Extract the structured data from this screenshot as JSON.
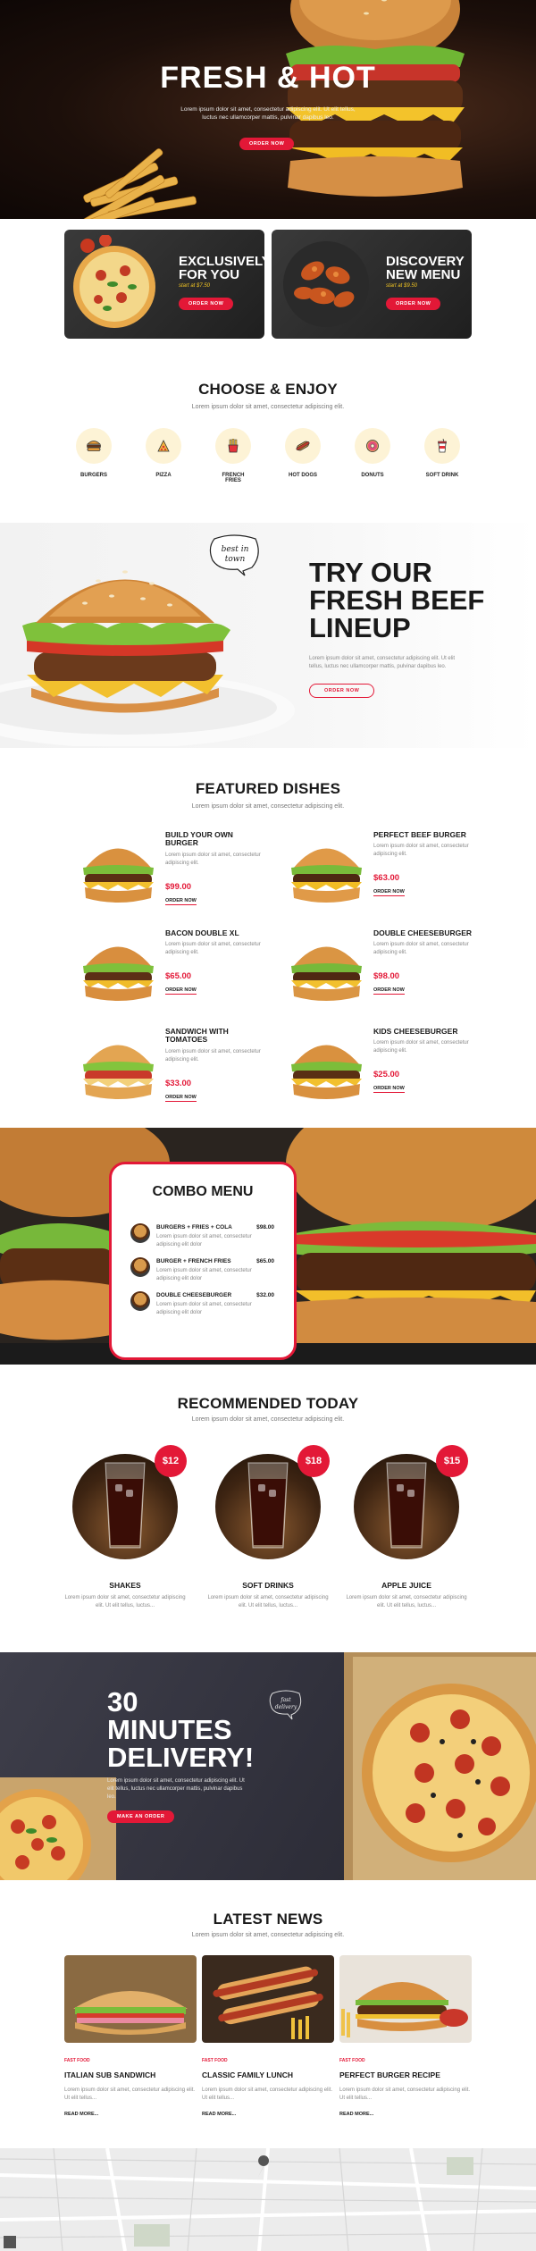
{
  "hero": {
    "title": "FRESH & HOT",
    "subtitle": "Lorem ipsum dolor sit amet, consectetur adipiscing elit. Ut elit tellus, luctus nec ullamcorper mattis, pulvinar dapibus leo.",
    "button": "ORDER NOW"
  },
  "promos": [
    {
      "title_line1": "EXCLUSIVELY",
      "title_line2": "FOR YOU",
      "price": "start at $7.50",
      "button": "ORDER NOW"
    },
    {
      "title_line1": "DISCOVERY",
      "title_line2": "NEW MENU",
      "price": "start at $9.50",
      "button": "ORDER NOW"
    }
  ],
  "choose": {
    "title": "CHOOSE & ENJOY",
    "subtitle": "Lorem ipsum dolor sit amet, consectetur adipiscing elit.",
    "categories": [
      {
        "label": "BURGERS",
        "icon": "burger-icon"
      },
      {
        "label": "PIZZA",
        "icon": "pizza-icon"
      },
      {
        "label": "FRENCH FRIES",
        "icon": "fries-icon"
      },
      {
        "label": "HOT DOGS",
        "icon": "hotdog-icon"
      },
      {
        "label": "DONUTS",
        "icon": "donut-icon"
      },
      {
        "label": "SOFT DRINK",
        "icon": "soda-icon"
      }
    ]
  },
  "beef": {
    "badge_line1": "best in",
    "badge_line2": "town",
    "title_line1": "TRY OUR",
    "title_line2": "FRESH BEEF",
    "title_line3": "LINEUP",
    "desc": "Lorem ipsum dolor sit amet, consectetur adipiscing elit. Ut elit tellus, luctus nec ullamcorper mattis, pulvinar dapibus leo.",
    "button": "ORDER NOW"
  },
  "featured": {
    "title": "FEATURED DISHES",
    "subtitle": "Lorem ipsum dolor sit amet, consectetur adipiscing elit.",
    "dishes": [
      {
        "name_line1": "BUILD YOUR OWN",
        "name_line2": "BURGER",
        "desc": "Lorem ipsum dolor sit amet, consectetur adipiscing elit.",
        "price": "$99.00",
        "order": "ORDER NOW"
      },
      {
        "name_line1": "PERFECT BEEF BURGER",
        "name_line2": "",
        "desc": "Lorem ipsum dolor sit amet, consectetur adipiscing elit.",
        "price": "$63.00",
        "order": "ORDER NOW"
      },
      {
        "name_line1": "BACON DOUBLE XL",
        "name_line2": "",
        "desc": "Lorem ipsum dolor sit amet, consectetur adipiscing elit.",
        "price": "$65.00",
        "order": "ORDER NOW"
      },
      {
        "name_line1": "DOUBLE CHEESEBURGER",
        "name_line2": "",
        "desc": "Lorem ipsum dolor sit amet, consectetur adipiscing elit.",
        "price": "$98.00",
        "order": "ORDER NOW"
      },
      {
        "name_line1": "SANDWICH WITH",
        "name_line2": "TOMATOES",
        "desc": "Lorem ipsum dolor sit amet, consectetur adipiscing elit.",
        "price": "$33.00",
        "order": "ORDER NOW"
      },
      {
        "name_line1": "KIDS CHEESEBURGER",
        "name_line2": "",
        "desc": "Lorem ipsum dolor sit amet, consectetur adipiscing elit.",
        "price": "$25.00",
        "order": "ORDER NOW"
      }
    ]
  },
  "combo": {
    "title": "COMBO MENU",
    "items": [
      {
        "name": "BURGERS + FRIES + COLA",
        "price": "$98.00",
        "desc": "Lorem ipsum dolor sit amet, consectetur adipiscing elit dolor"
      },
      {
        "name": "BURGER + FRENCH FRIES",
        "price": "$65.00",
        "desc": "Lorem ipsum dolor sit amet, consectetur adipiscing elit dolor"
      },
      {
        "name": "DOUBLE CHEESEBURGER",
        "price": "$32.00",
        "desc": "Lorem ipsum dolor sit amet, consectetur adipiscing elit dolor"
      }
    ]
  },
  "recommended": {
    "title": "RECOMMENDED TODAY",
    "subtitle": "Lorem ipsum dolor sit amet, consectetur adipiscing elit.",
    "drinks": [
      {
        "name": "SHAKES",
        "price": "$12",
        "desc": "Lorem ipsum dolor sit amet, consectetur adipiscing elit. Ut elit tellus, luctus..."
      },
      {
        "name": "SOFT DRINKS",
        "price": "$18",
        "desc": "Lorem ipsum dolor sit amet, consectetur adipiscing elit. Ut elit tellus, luctus..."
      },
      {
        "name": "APPLE JUICE",
        "price": "$15",
        "desc": "Lorem ipsum dolor sit amet, consectetur adipiscing elit. Ut elit tellus, luctus..."
      }
    ]
  },
  "delivery": {
    "title_line1": "30",
    "title_line2": "MINUTES",
    "title_line3": "DELIVERY!",
    "badge_line1": "fast",
    "badge_line2": "delivery",
    "desc": "Lorem ipsum dolor sit amet, consectetur adipiscing elit. Ut elit tellus, luctus nec ullamcorper mattis, pulvinar dapibus leo.",
    "button": "MAKE AN ORDER"
  },
  "news": {
    "title": "LATEST NEWS",
    "subtitle": "Lorem ipsum dolor sit amet, consectetur adipiscing elit.",
    "posts": [
      {
        "tag": "FAST FOOD",
        "title": "ITALIAN SUB SANDWICH",
        "desc": "Lorem ipsum dolor sit amet, consectetur adipiscing elit. Ut elit tellus...",
        "more": "READ MORE..."
      },
      {
        "tag": "FAST FOOD",
        "title": "CLASSIC FAMILY LUNCH",
        "desc": "Lorem ipsum dolor sit amet, consectetur adipiscing elit. Ut elit tellus...",
        "more": "READ MORE..."
      },
      {
        "tag": "FAST FOOD",
        "title": "PERFECT BURGER RECIPE",
        "desc": "Lorem ipsum dolor sit amet, consectetur adipiscing elit. Ut elit tellus...",
        "more": "READ MORE..."
      }
    ]
  },
  "colors": {
    "accent": "#e31837",
    "cream": "#fdf3d6",
    "dark": "#1a1a1a"
  }
}
